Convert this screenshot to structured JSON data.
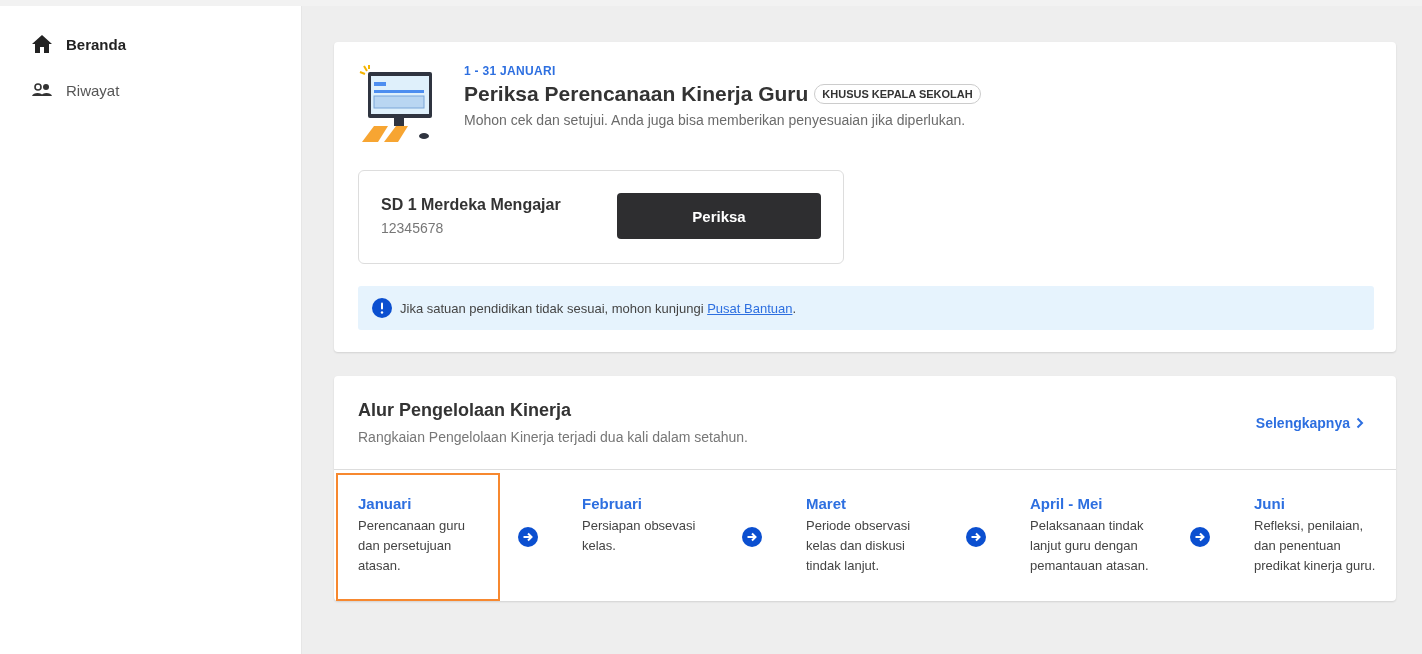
{
  "sidebar": {
    "items": [
      {
        "label": "Beranda",
        "selected": true
      },
      {
        "label": "Riwayat",
        "selected": false
      }
    ]
  },
  "task_card": {
    "date": "1 - 31 JANUARI",
    "title": "Periksa Perencanaan Kinerja Guru",
    "badge": "KHUSUS KEPALA SEKOLAH",
    "description": "Mohon cek dan setujui. Anda juga bisa memberikan penyesuaian jika diperlukan.",
    "school": {
      "name": "SD 1 Merdeka Mengajar",
      "code": "12345678",
      "button": "Periksa"
    },
    "notice": {
      "text": "Jika satuan pendidikan tidak sesuai, mohon kunjungi ",
      "link": "Pusat Bantuan",
      "suffix": "."
    }
  },
  "flow_card": {
    "title": "Alur Pengelolaan Kinerja",
    "subtitle": "Rangkaian Pengelolaan Kinerja terjadi dua kali dalam setahun.",
    "more_link": "Selengkapnya",
    "steps": [
      {
        "month": "Januari",
        "description": "Perencanaan guru dan persetujuan atasan.",
        "selected": true
      },
      {
        "month": "Februari",
        "description": "Persiapan obsevasi kelas.",
        "selected": false
      },
      {
        "month": "Maret",
        "description": "Periode observasi kelas dan diskusi tindak lanjut.",
        "selected": false
      },
      {
        "month": "April - Mei",
        "description": "Pelaksanaan tindak lanjut guru dengan pemantauan atasan.",
        "selected": false
      },
      {
        "month": "Juni",
        "description": "Refleksi, penilaian, dan penentuan predikat kinerja guru.",
        "selected": false
      }
    ]
  }
}
